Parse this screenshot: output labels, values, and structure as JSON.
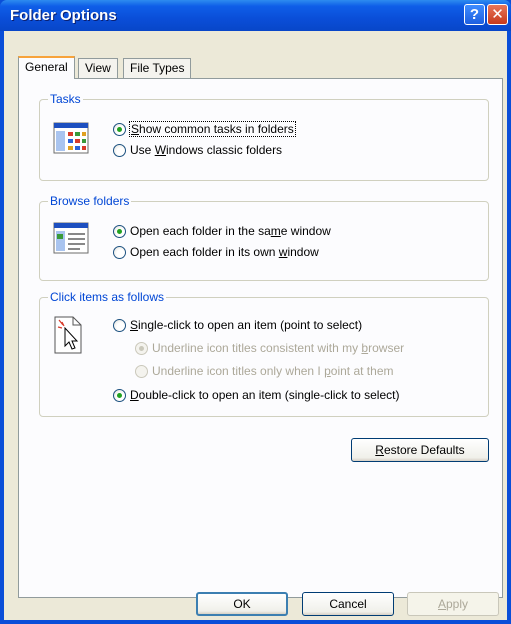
{
  "window": {
    "title": "Folder Options"
  },
  "tabs": [
    {
      "label": "General",
      "active": true
    },
    {
      "label": "View",
      "active": false
    },
    {
      "label": "File Types",
      "active": false
    }
  ],
  "tasks": {
    "legend": "Tasks",
    "icon": "tasks-pane-icon",
    "options": [
      {
        "pre": "",
        "key": "S",
        "post": "how common tasks in folders",
        "checked": true
      },
      {
        "pre": "Use ",
        "key": "W",
        "post": "indows classic folders",
        "checked": false
      }
    ]
  },
  "browse": {
    "legend": "Browse folders",
    "icon": "browse-window-icon",
    "options": [
      {
        "pre": "Open each folder in the sa",
        "key": "m",
        "post": "e window",
        "checked": true
      },
      {
        "pre": "Open each folder in its own ",
        "key": "w",
        "post": "indow",
        "checked": false
      }
    ]
  },
  "click": {
    "legend": "Click items as follows",
    "icon": "pointer-click-icon",
    "single": {
      "pre": "",
      "key": "S",
      "post": "ingle-click to open an item (point to select)",
      "checked": false
    },
    "sub1": {
      "pre": "Underline icon titles consistent with my ",
      "key": "b",
      "post": "rowser",
      "checked": true
    },
    "sub2": {
      "pre": "Underline icon titles only when I ",
      "key": "p",
      "post": "oint at them",
      "checked": false
    },
    "double": {
      "pre": "",
      "key": "D",
      "post": "ouble-click to open an item (single-click to select)",
      "checked": true
    }
  },
  "restore": {
    "pre": "",
    "key": "R",
    "post": "estore Defaults"
  },
  "buttons": {
    "ok": "OK",
    "cancel": "Cancel",
    "apply_pre": "",
    "apply_key": "A",
    "apply_post": "pply"
  },
  "colors": {
    "titlebar": "#0A4ED8",
    "dialog": "#ECE9D8",
    "legend": "#0046D5",
    "radio_check": "#21A121"
  }
}
